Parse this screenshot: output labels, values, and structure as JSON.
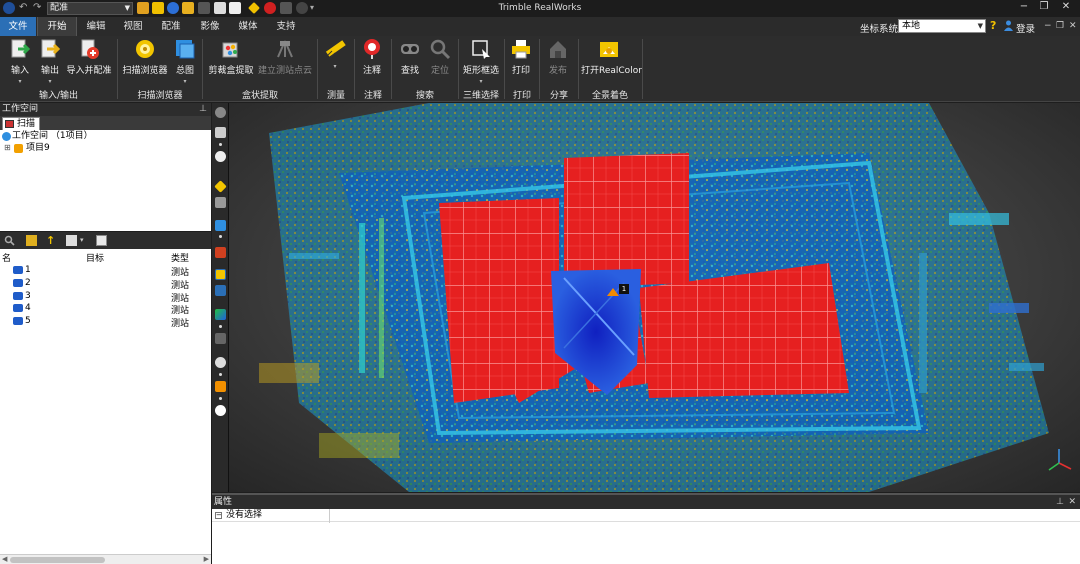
{
  "window": {
    "title": "Trimble RealWorks",
    "quick_access_combo": "配准"
  },
  "menu": {
    "tabs": [
      "文件",
      "开始",
      "编辑",
      "视图",
      "配准",
      "影像",
      "媒体",
      "支持"
    ],
    "coord_system_label": "坐标系统",
    "coord_system_value": "本地",
    "login": "登录",
    "help": "?"
  },
  "ribbon": {
    "buttons": [
      {
        "label": "输入",
        "dropdown": "▾"
      },
      {
        "label": "输出",
        "dropdown": "▾"
      },
      {
        "label": "导入并配准"
      },
      {
        "label": "扫描浏览器"
      },
      {
        "label": "总图",
        "dropdown": "▾"
      },
      {
        "label": "剪裁盒提取"
      },
      {
        "label": "建立测站点云",
        "disabled": true
      },
      {
        "label": "",
        "dropdown": "▾"
      },
      {
        "label": "注释"
      },
      {
        "label": "查找"
      },
      {
        "label": "定位",
        "disabled": true
      },
      {
        "label": "矩形框选",
        "dropdown": "▾"
      },
      {
        "label": "打印"
      },
      {
        "label": "发布",
        "disabled": true
      },
      {
        "label": "打开RealColor"
      }
    ],
    "groups": [
      "输入/输出",
      "扫描浏览器",
      "盒状提取",
      "测量",
      "注释",
      "搜索",
      "三维选择",
      "打印",
      "分享",
      "全景着色"
    ]
  },
  "workspace": {
    "title": "工作空间",
    "tab": "扫描",
    "root": "工作空间 （1项目）",
    "project": "项目9"
  },
  "station_list": {
    "headers": [
      "名",
      "目标",
      "类型"
    ],
    "rows": [
      {
        "name": "1",
        "type": "测站"
      },
      {
        "name": "2",
        "type": "测站"
      },
      {
        "name": "3",
        "type": "测站"
      },
      {
        "name": "4",
        "type": "测站"
      },
      {
        "name": "5",
        "type": "测站"
      }
    ]
  },
  "viewport": {
    "station_marker": "1"
  },
  "properties": {
    "title": "属性",
    "empty_text": "没有选择"
  },
  "icons": {
    "app": "app-logo-icon",
    "undo": "undo-icon",
    "redo": "redo-icon",
    "user": "user-icon",
    "station": "camera-station-icon"
  },
  "colors": {
    "accent": "#2b6fb6",
    "background": "#2d2d2d",
    "pointcloud_high": "#e62020",
    "pointcloud_low": "#1a3fd0"
  }
}
